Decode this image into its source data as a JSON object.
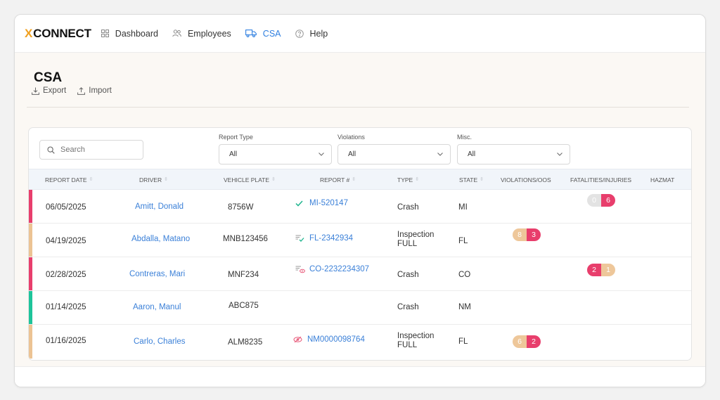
{
  "app": {
    "logo_x": "X",
    "logo_text": "CONNECT",
    "nav": [
      {
        "label": "Dashboard",
        "icon": "grid-icon"
      },
      {
        "label": "Employees",
        "icon": "people-icon"
      },
      {
        "label": "CSA",
        "icon": "truck-icon",
        "active": true
      },
      {
        "label": "Help",
        "icon": "help-circle-icon"
      }
    ]
  },
  "page": {
    "title": "CSA",
    "export_label": "Export",
    "import_label": "Import"
  },
  "filters": {
    "search_placeholder": "Search",
    "report_type_label": "Report Type",
    "report_type_value": "All",
    "violations_label": "Violations",
    "violations_value": "All",
    "misc_label": "Misc.",
    "misc_value": "All"
  },
  "table": {
    "headers": {
      "report_date": "REPORT DATE",
      "driver": "DRIVER",
      "vehicle_plate": "VEHICLE PLATE",
      "report_num": "REPORT #",
      "type": "TYPE",
      "state": "STATE",
      "violations_oos": "VIOLATIONS/OOS",
      "fatalities_injuries": "FATALITIES/INJURIES",
      "hazmat": "HAZMAT"
    },
    "rows": [
      {
        "date": "06/05/2025",
        "driver": "Amitt, Donald",
        "plate": "8756W",
        "report": "MI-520147",
        "report_icon": "check-icon",
        "type_line1": "Crash",
        "type_line2": "",
        "state": "MI",
        "violations": null,
        "fatalities": [
          "0",
          "6"
        ],
        "stripe": "#e83e6c"
      },
      {
        "date": "04/19/2025",
        "driver": "Abdalla, Matano",
        "plate": "MNB123456",
        "report": "FL-2342934",
        "report_icon": "list-check-icon",
        "type_line1": "Inspection",
        "type_line2": "FULL",
        "state": "FL",
        "violations": [
          "8",
          "3"
        ],
        "fatalities": null,
        "stripe": "#ecc393"
      },
      {
        "date": "02/28/2025",
        "driver": "Contreras, Mari",
        "plate": "MNF234",
        "report": "CO-2232234307",
        "report_icon": "list-eye-icon",
        "type_line1": "Crash",
        "type_line2": "",
        "state": "CO",
        "violations": null,
        "fatalities": [
          "2",
          "1"
        ],
        "stripe": "#e83e6c"
      },
      {
        "date": "01/14/2025",
        "driver": "Aaron, Manul",
        "plate": "ABC875",
        "report": "",
        "report_icon": "",
        "type_line1": "Crash",
        "type_line2": "",
        "state": "NM",
        "violations": null,
        "fatalities": null,
        "stripe": "#1ec49a"
      },
      {
        "date": "01/16/2025",
        "driver": "Carlo, Charles",
        "plate": "ALM8235",
        "report": "NM0000098764",
        "report_icon": "eye-slash-icon",
        "type_line1": "Inspection",
        "type_line2": "FULL",
        "state": "FL",
        "violations": [
          "6",
          "2"
        ],
        "fatalities": null,
        "stripe": "#ecc393"
      }
    ]
  },
  "colors": {
    "accent": "#2f7fe0",
    "logo_accent": "#f0a020",
    "pill_pink": "#e83e6c",
    "pill_tan": "#eec79a",
    "pill_gray": "#e3e3e3",
    "stripe_green": "#1ec49a"
  }
}
